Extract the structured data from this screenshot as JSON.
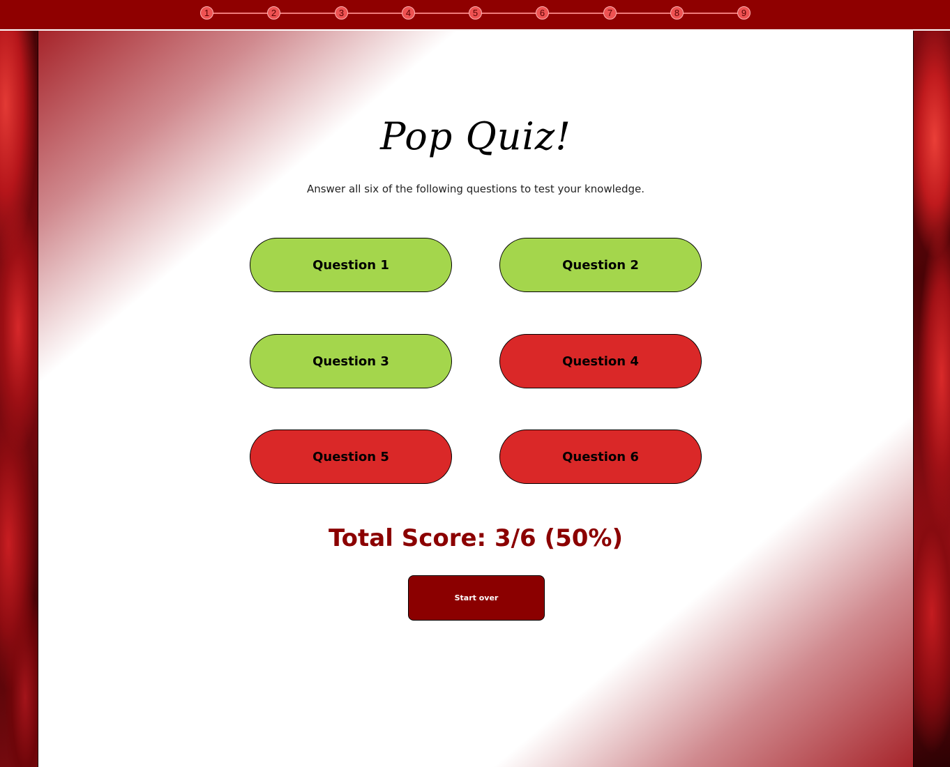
{
  "progress": {
    "steps": [
      "1",
      "2",
      "3",
      "4",
      "5",
      "6",
      "7",
      "8",
      "9"
    ],
    "accent": "#8f0000"
  },
  "quiz": {
    "title": "Pop Quiz!",
    "subtitle": "Answer all six of the following questions to test your knowledge.",
    "questions": [
      {
        "label": "Question 1",
        "status": "correct"
      },
      {
        "label": "Question 2",
        "status": "correct"
      },
      {
        "label": "Question 3",
        "status": "correct"
      },
      {
        "label": "Question 4",
        "status": "incorrect"
      },
      {
        "label": "Question 5",
        "status": "incorrect"
      },
      {
        "label": "Question 6",
        "status": "incorrect"
      }
    ],
    "score_text": "Total Score: 3/6 (50%)",
    "restart_label": "Start over"
  },
  "colors": {
    "correct": "#a4d64c",
    "incorrect": "#da2828",
    "score_text": "#8b0000",
    "restart_button": "#8b0000"
  }
}
